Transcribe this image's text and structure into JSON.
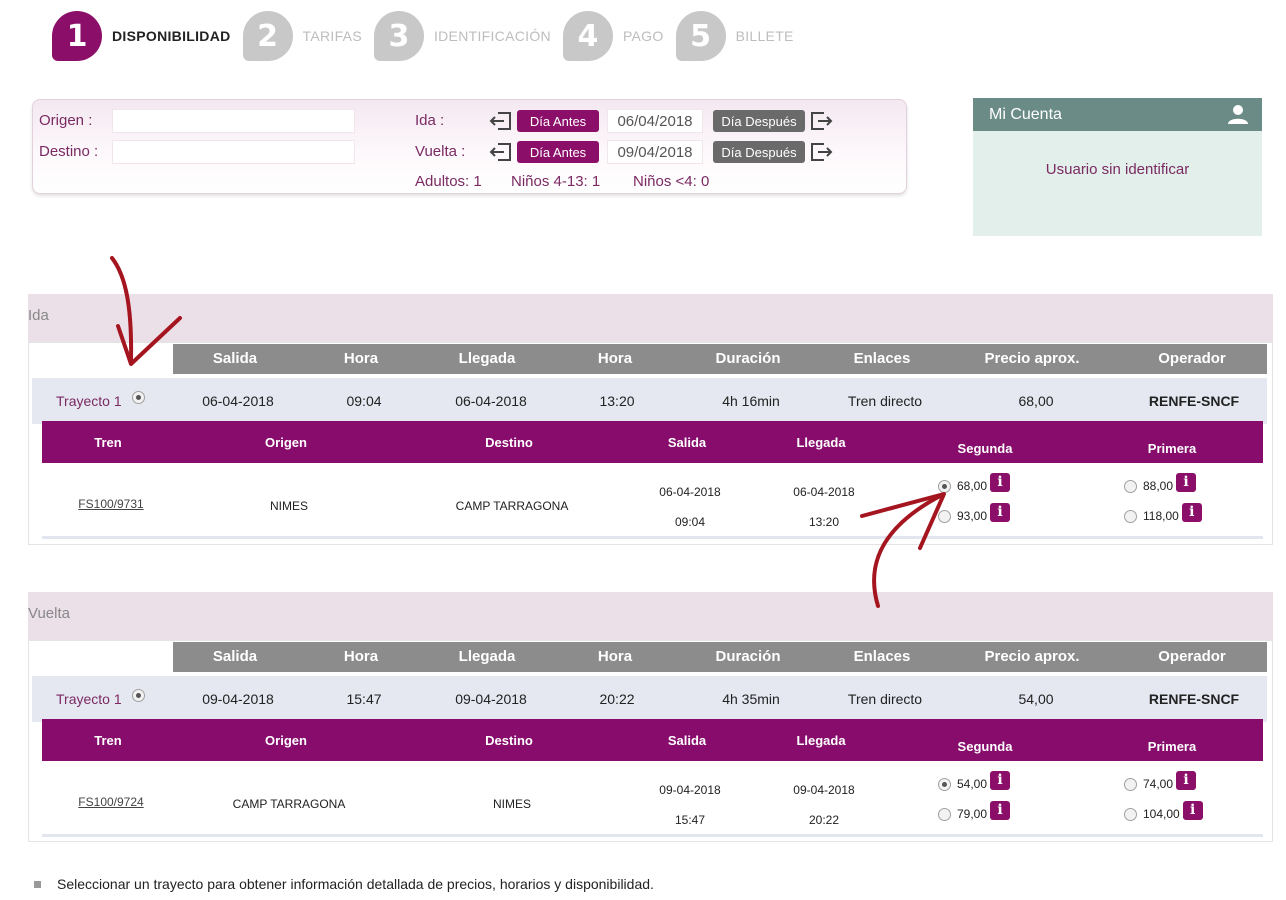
{
  "steps": [
    {
      "number": "1",
      "label": "DISPONIBILIDAD"
    },
    {
      "number": "2",
      "label": "TARIFAS"
    },
    {
      "number": "3",
      "label": "IDENTIFICACIÓN"
    },
    {
      "number": "4",
      "label": "PAGO"
    },
    {
      "number": "5",
      "label": "BILLETE"
    }
  ],
  "search": {
    "origen_label": "Origen :",
    "origen_value": "",
    "destino_label": "Destino :",
    "destino_value": "",
    "ida_label": "Ida :",
    "ida_date": "06/04/2018",
    "vuelta_label": "Vuelta :",
    "vuelta_date": "09/04/2018",
    "dia_antes": "Día Antes",
    "dia_despues": "Día Después",
    "adultos": "Adultos: 1",
    "ninos_4_13": "Niños 4-13: 1",
    "ninos_4": "Niños <4: 0"
  },
  "account": {
    "title": "Mi Cuenta",
    "status": "Usuario sin identificar",
    "icon": "user-icon"
  },
  "columns": [
    "Salida",
    "Hora",
    "Llegada",
    "Hora",
    "Duración",
    "Enlaces",
    "Precio aprox.",
    "Operador"
  ],
  "train_columns": [
    "Tren",
    "Origen",
    "Destino",
    "Salida",
    "Llegada",
    "Segunda",
    "Primera"
  ],
  "ida": {
    "title": "Ida",
    "summary": {
      "trayecto": "Trayecto 1",
      "salida": "06-04-2018",
      "hora_salida": "09:04",
      "llegada": "06-04-2018",
      "hora_llegada": "13:20",
      "duracion": "4h 16min",
      "enlaces": "Tren directo",
      "precio": "68,00",
      "operador": "RENFE-SNCF"
    },
    "train": {
      "tren": "FS100/9731",
      "origen": "NIMES",
      "destino": "CAMP TARRAGONA",
      "salida_fecha": "06-04-2018",
      "salida_hora": "09:04",
      "llegada_fecha": "06-04-2018",
      "llegada_hora": "13:20",
      "segunda": [
        "68,00",
        "93,00"
      ],
      "primera": [
        "88,00",
        "118,00"
      ]
    }
  },
  "vuelta": {
    "title": "Vuelta",
    "summary": {
      "trayecto": "Trayecto 1",
      "salida": "09-04-2018",
      "hora_salida": "15:47",
      "llegada": "09-04-2018",
      "hora_llegada": "20:22",
      "duracion": "4h 35min",
      "enlaces": "Tren directo",
      "precio": "54,00",
      "operador": "RENFE-SNCF"
    },
    "train": {
      "tren": "FS100/9724",
      "origen": "CAMP TARRAGONA",
      "destino": "NIMES",
      "salida_fecha": "09-04-2018",
      "salida_hora": "15:47",
      "llegada_fecha": "09-04-2018",
      "llegada_hora": "20:22",
      "segunda": [
        "54,00",
        "79,00"
      ],
      "primera": [
        "74,00",
        "104,00"
      ]
    }
  },
  "info_glyph": "i",
  "note": "Seleccionar un trayecto para obtener información detallada de precios, horarios y disponibilidad.",
  "colors": {
    "brand": "#8b0e68",
    "header_grey": "#8c8c8c",
    "account_header": "#6b8c86",
    "annotation_arrow": "#a5151f"
  }
}
